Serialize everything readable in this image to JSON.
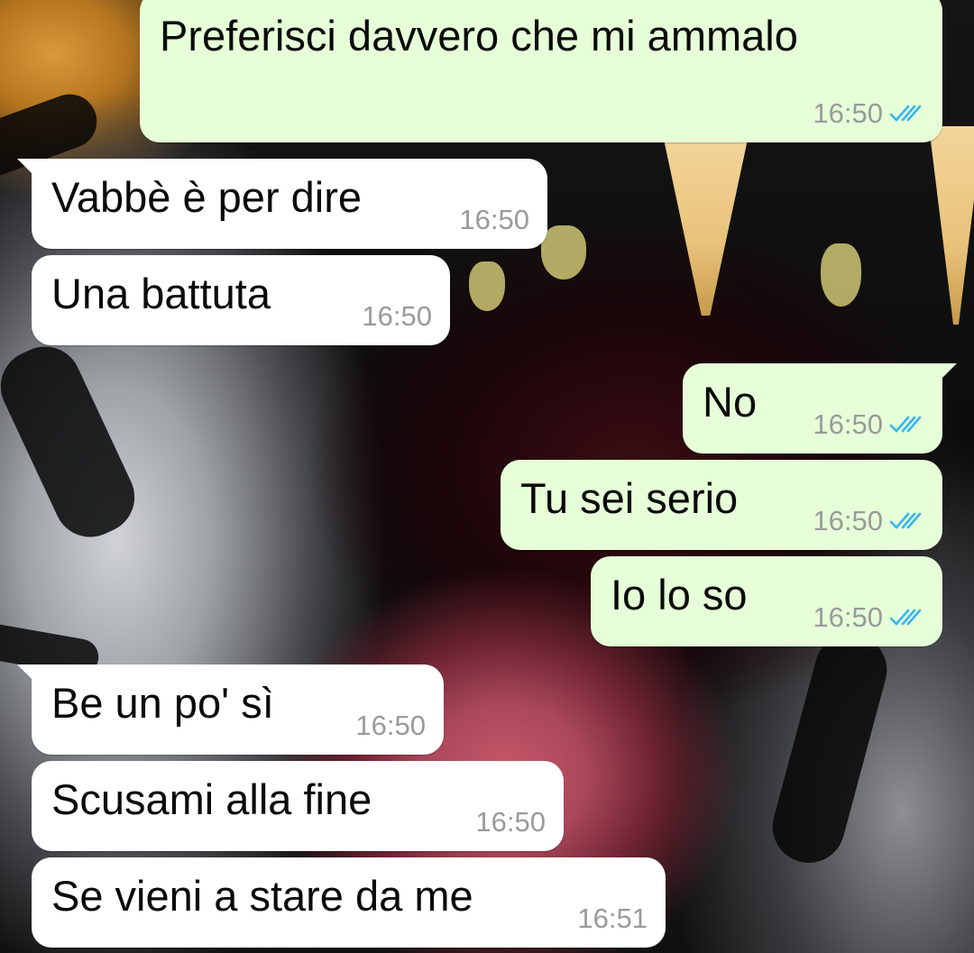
{
  "messages": [
    {
      "direction": "out",
      "text": "Preferisci davvero che mi ammalo",
      "time": "16:50",
      "status_icon": "double-check-read-icon"
    },
    {
      "direction": "in",
      "text": "Vabbè è per dire",
      "time": "16:50"
    },
    {
      "direction": "in",
      "text": "Una battuta",
      "time": "16:50"
    },
    {
      "direction": "out",
      "text": "No",
      "time": "16:50",
      "status_icon": "double-check-read-icon"
    },
    {
      "direction": "out",
      "text": "Tu sei serio",
      "time": "16:50",
      "status_icon": "double-check-read-icon"
    },
    {
      "direction": "out",
      "text": "Io lo so",
      "time": "16:50",
      "status_icon": "double-check-read-icon"
    },
    {
      "direction": "in",
      "text": "Be un po' sì",
      "time": "16:50"
    },
    {
      "direction": "in",
      "text": "Scusami alla fine",
      "time": "16:50"
    },
    {
      "direction": "in",
      "text": "Se vieni a stare da me",
      "time": "16:51"
    }
  ],
  "colors": {
    "outgoing_bubble": "#e6ffd8",
    "incoming_bubble": "#ffffff",
    "timestamp": "#9a9a9a",
    "read_ticks": "#34b7f1"
  }
}
